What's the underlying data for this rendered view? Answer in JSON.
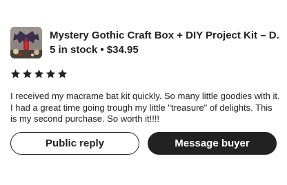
{
  "product": {
    "title": "Mystery Gothic Craft Box + DIY Project Kit – D...",
    "stock_price": "5 in stock • $34.95",
    "image_icon": "product-thumbnail-bat-kit"
  },
  "review": {
    "rating": 5,
    "rating_max": 5,
    "star_color": "#222222",
    "text": "I received my macrame bat kit quickly. So many little goodies with it. I had a great time going trough my little \"treasure\" of delights. This is my second purchase.  So worth it!!!!"
  },
  "actions": {
    "public_reply_label": "Public reply",
    "message_buyer_label": "Message buyer"
  }
}
